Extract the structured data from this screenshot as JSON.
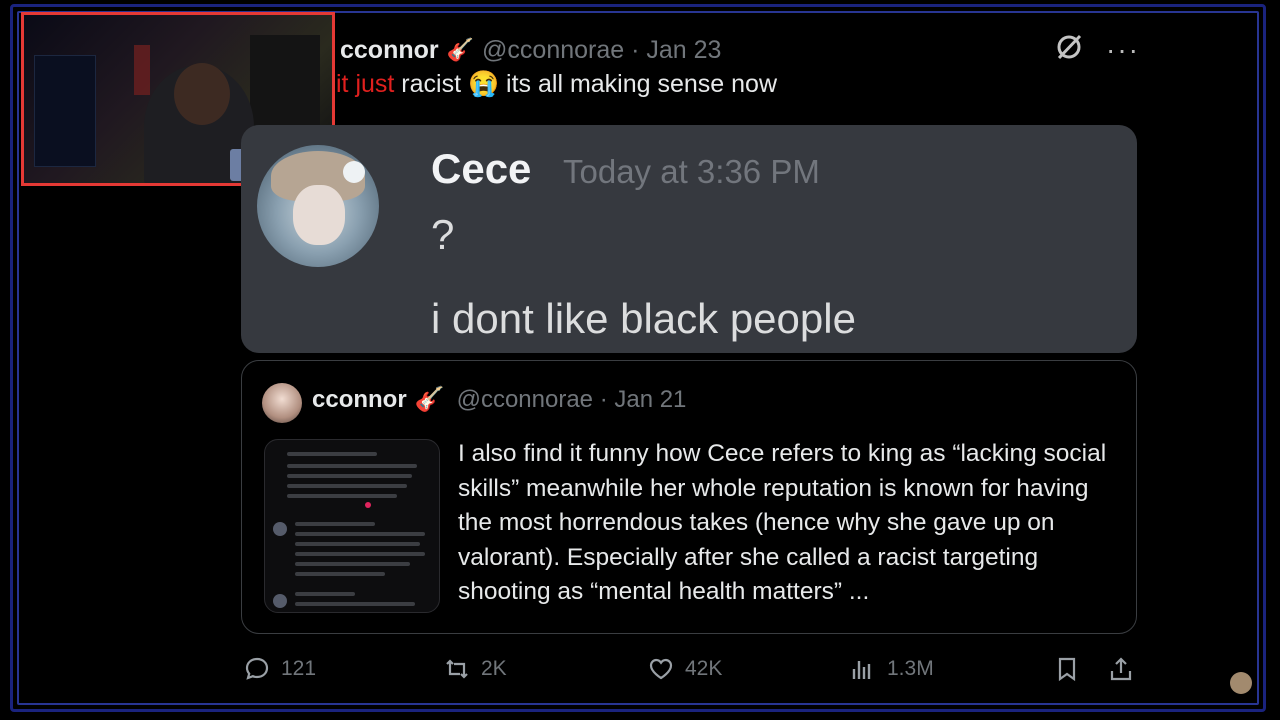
{
  "tweet": {
    "author_name": "cconnor",
    "author_emoji": "🎸",
    "handle_date": "@cconnorae · Jan 23",
    "text_highlight": "it just",
    "text_rest": " racist 😭 its all making sense now",
    "more_label": "···"
  },
  "discord": {
    "name": "Cece",
    "time": "Today at 3:36 PM",
    "message1": "?",
    "message2": "i dont like black people"
  },
  "quote": {
    "name": "cconnor",
    "emoji": "🎸",
    "handle_date": "@cconnorae · Jan 21",
    "text": "I also find it funny how Cece refers to king as “lacking social skills” meanwhile her whole reputation is known for having the most horrendous takes (hence why she gave up on valorant).  Especially after she called a racist targeting shooting as “mental health matters”  ..."
  },
  "actions": {
    "replies": "121",
    "reposts": "2K",
    "likes": "42K",
    "views": "1.3M"
  },
  "colors": {
    "accent_red": "#e0201e",
    "discord_bg": "#36393f",
    "muted": "#71767b"
  }
}
